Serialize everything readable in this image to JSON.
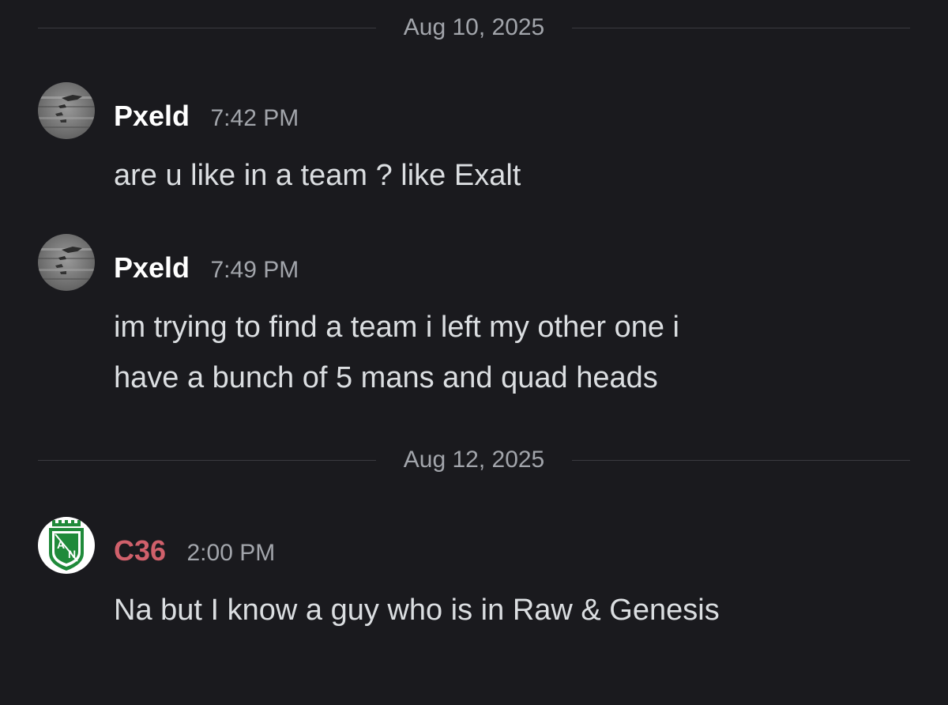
{
  "dividers": [
    {
      "date": "Aug 10, 2025"
    },
    {
      "date": "Aug 12, 2025"
    }
  ],
  "messages": [
    {
      "author": "Pxeld",
      "time": "7:42 PM",
      "lines": [
        "are u like in a team ? like Exalt"
      ]
    },
    {
      "author": "Pxeld",
      "time": "7:49 PM",
      "lines": [
        "im trying to find a team i left my other one i",
        "have a bunch of 5 mans and quad heads"
      ]
    },
    {
      "author": "C36",
      "time": "2:00 PM",
      "lines": [
        "Na but I know a guy who is in Raw & Genesis"
      ]
    }
  ],
  "avatars": {
    "pxeld": "grey-textured-avatar",
    "c36": "green-white-club-crest-avatar"
  },
  "colors": {
    "background": "#1a1a1e",
    "username_default": "#ffffff",
    "username_c36": "#d0606b",
    "timestamp": "#a2a5ab",
    "message_text": "#dbdee1",
    "divider_line": "#3a3b40"
  },
  "logo_text": {
    "c36_crest_letters": "AN"
  }
}
